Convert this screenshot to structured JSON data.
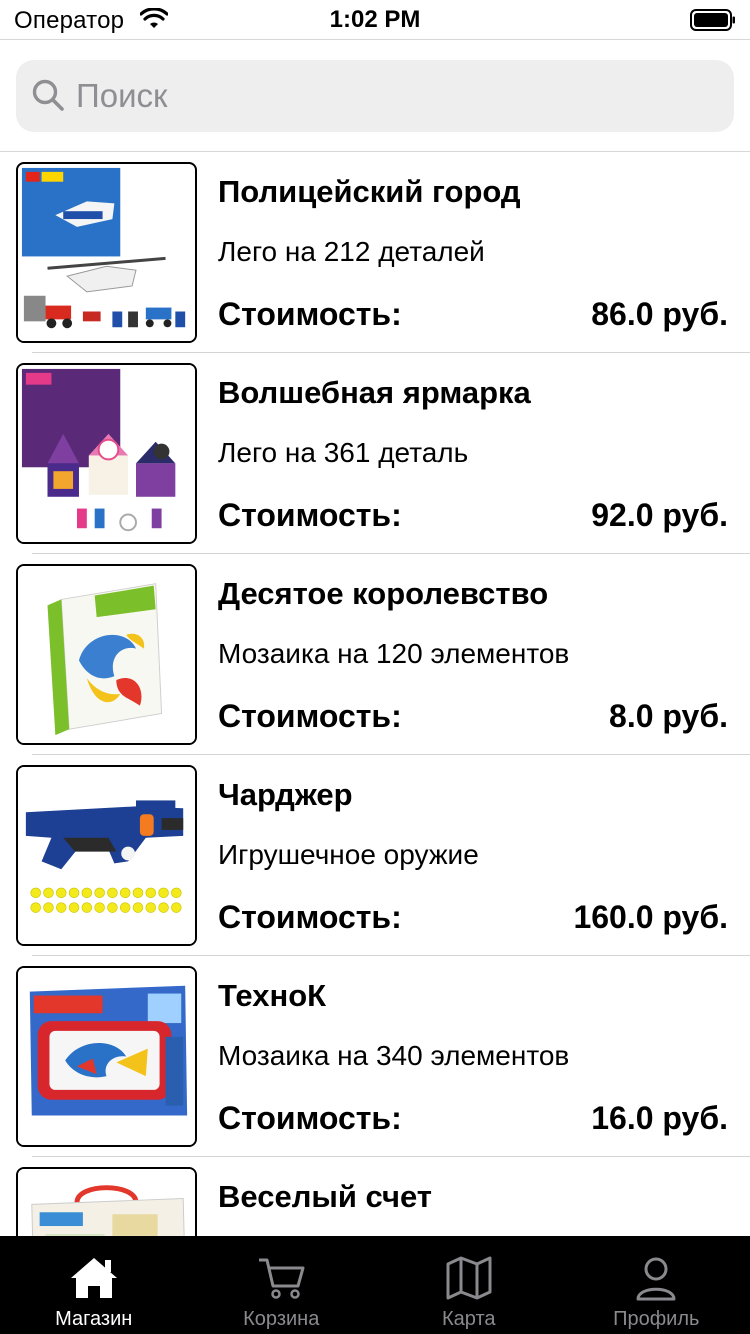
{
  "status_bar": {
    "carrier": "Оператор",
    "time": "1:02 PM"
  },
  "search": {
    "placeholder": "Поиск"
  },
  "products": [
    {
      "name": "Полицейский город",
      "description": "Лего на 212 деталей",
      "price_label": "Стоимость:",
      "price": "86.0 руб.",
      "image_icon": "lego-city-police-box"
    },
    {
      "name": "Волшебная ярмарка",
      "description": "Лего на 361 деталь",
      "price_label": "Стоимость:",
      "price": "92.0 руб.",
      "image_icon": "lego-friends-fair-box"
    },
    {
      "name": "Десятое королевство",
      "description": "Мозаика на 120 элементов",
      "price_label": "Стоимость:",
      "price": "8.0 руб.",
      "image_icon": "mosaic-box"
    },
    {
      "name": "Чарджер",
      "description": "Игрушечное оружие",
      "price_label": "Стоимость:",
      "price": "160.0 руб.",
      "image_icon": "toy-blaster"
    },
    {
      "name": "ТехноК",
      "description": "Мозаика на 340 элементов",
      "price_label": "Стоимость:",
      "price": "16.0 руб.",
      "image_icon": "mosaic-set-box"
    },
    {
      "name": "Веселый счет",
      "description": "",
      "price_label": "",
      "price": "",
      "image_icon": "puzzle-box"
    }
  ],
  "tabs": [
    {
      "label": "Магазин",
      "icon": "home-icon",
      "active": true
    },
    {
      "label": "Корзина",
      "icon": "cart-icon",
      "active": false
    },
    {
      "label": "Карта",
      "icon": "map-icon",
      "active": false
    },
    {
      "label": "Профиль",
      "icon": "profile-icon",
      "active": false
    }
  ],
  "colors": {
    "tab_bar_bg": "#000000",
    "tab_active": "#ffffff",
    "tab_inactive": "#8a8a8e",
    "search_bg": "#eeeeef"
  }
}
